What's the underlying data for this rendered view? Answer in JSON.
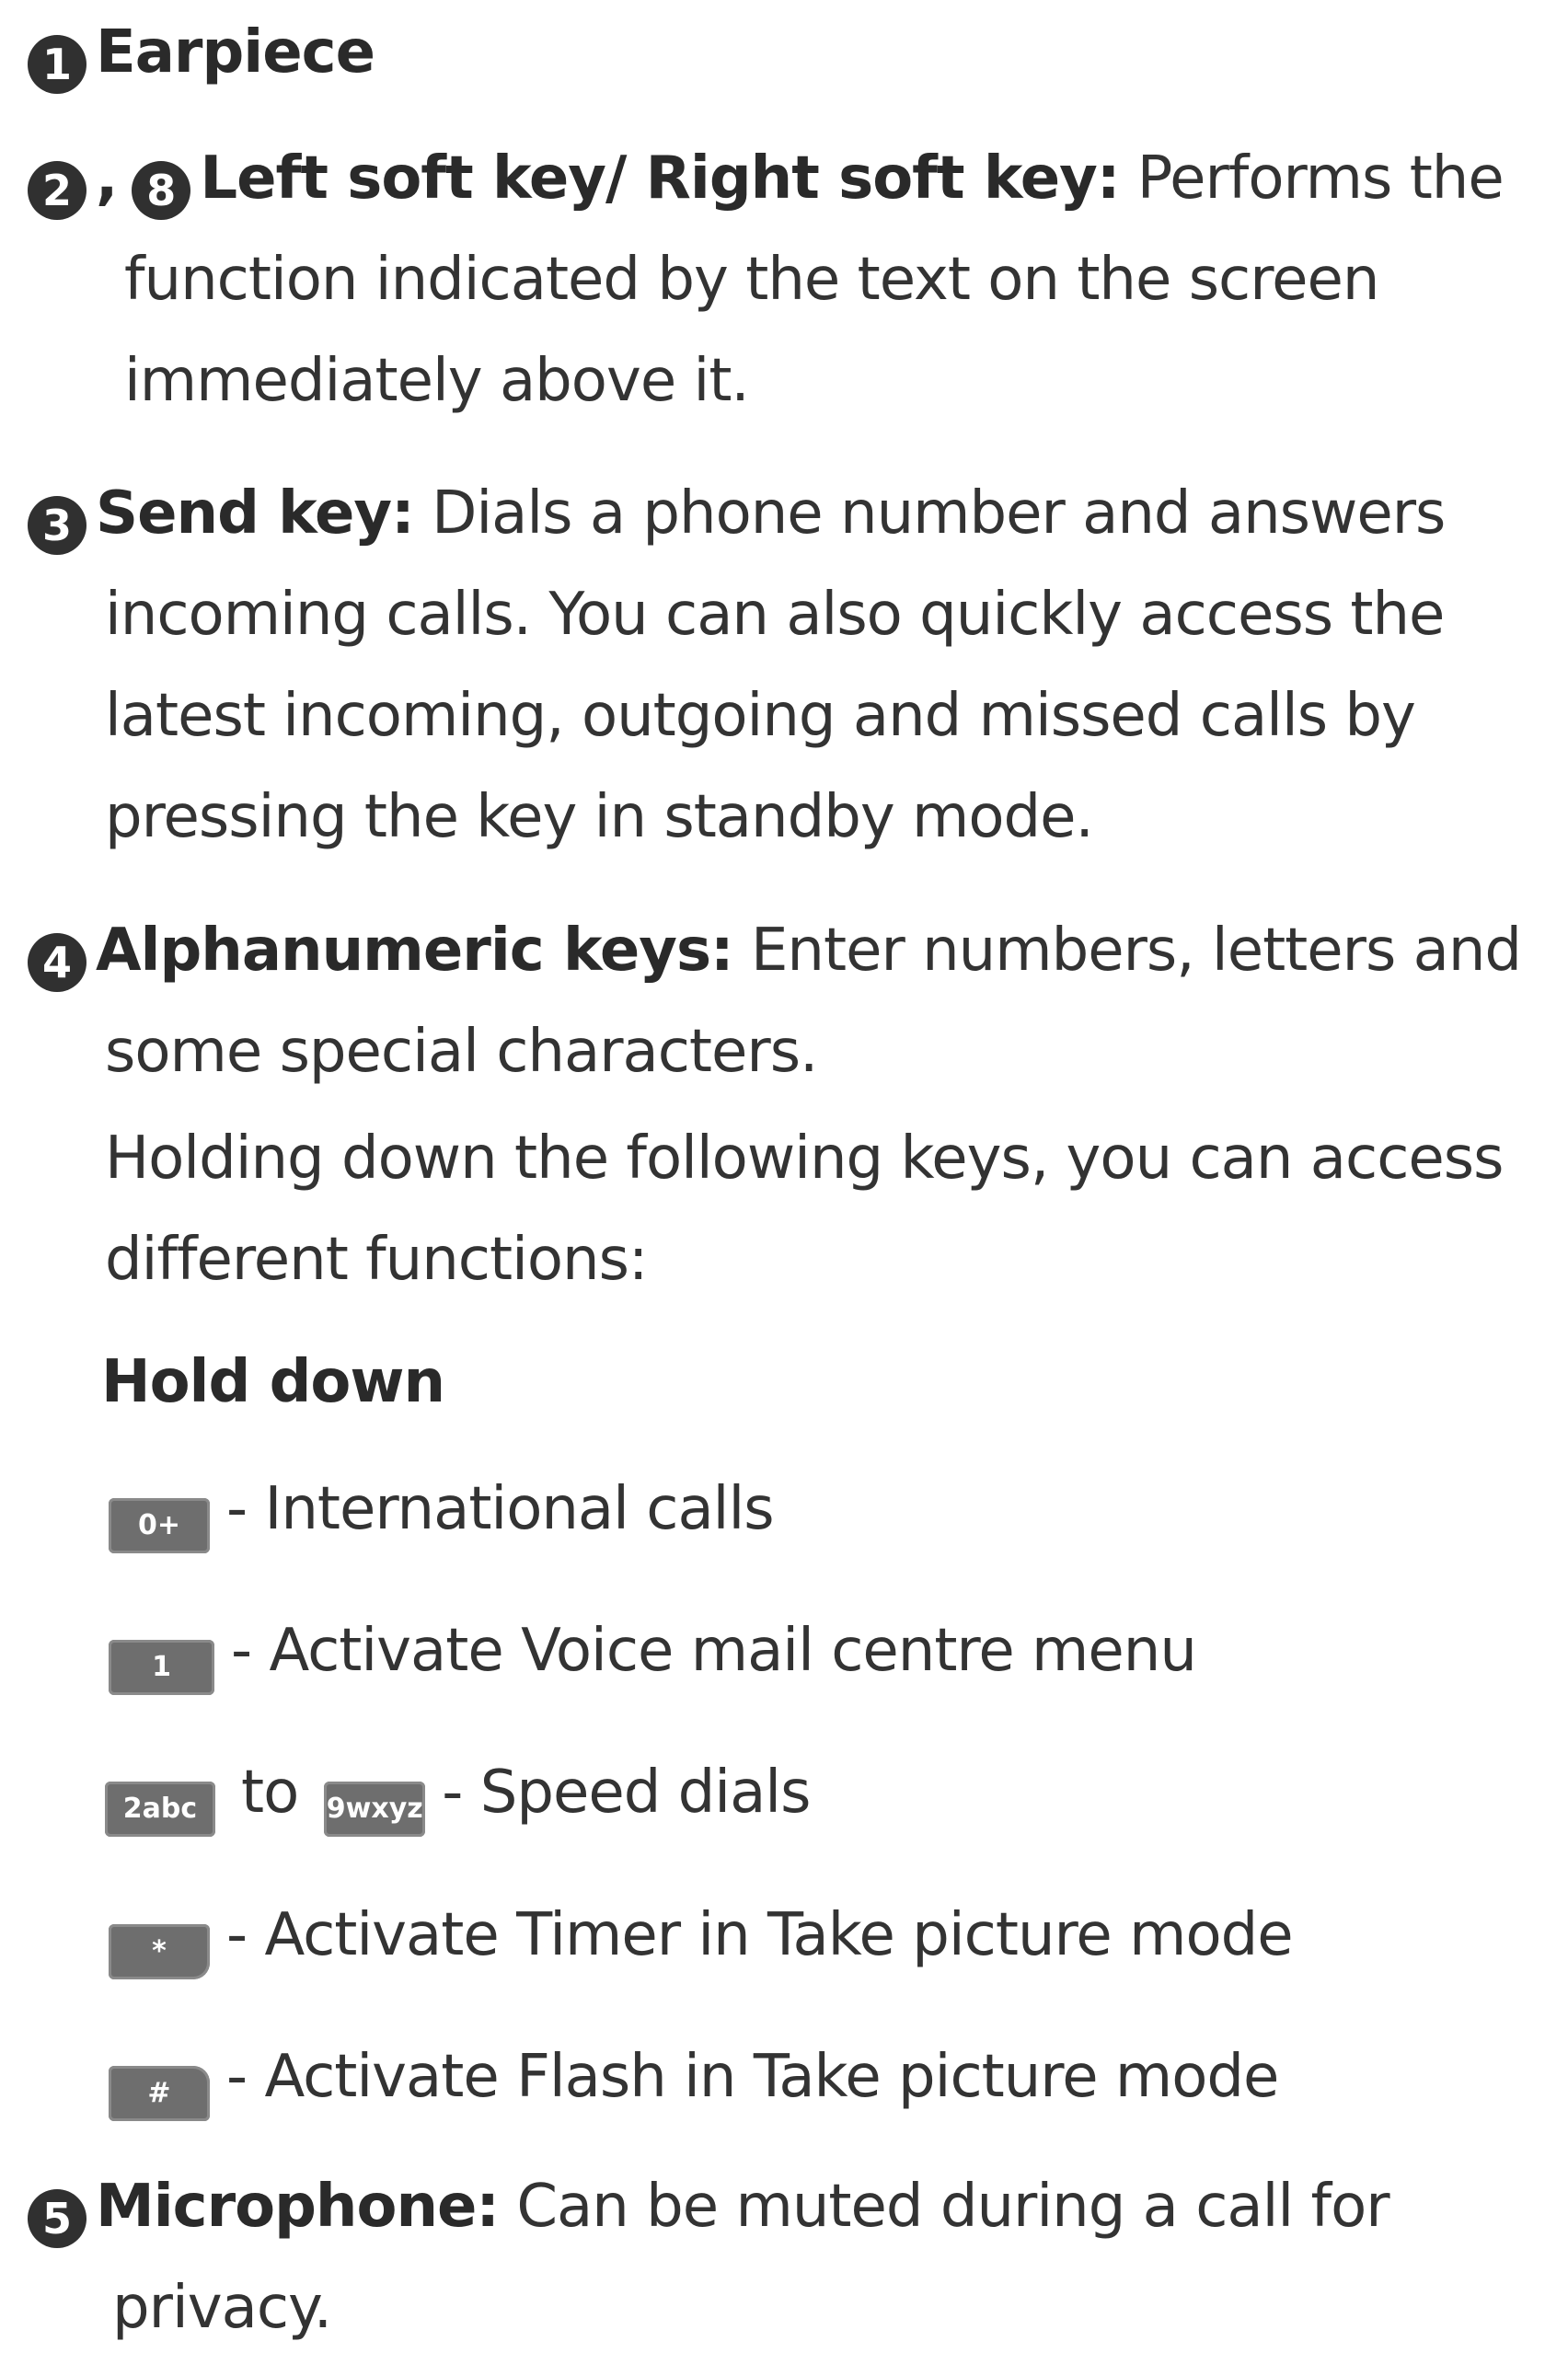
{
  "items": [
    {
      "number": "1",
      "title": "Earpiece"
    },
    {
      "number": "2",
      "number2": "8",
      "title": "Left soft key/ Right soft key:",
      "desc_lines": [
        "Performs the",
        "function indicated by the text on the screen",
        "immediately above it."
      ]
    },
    {
      "number": "3",
      "title": "Send key:",
      "desc_lines": [
        "Dials a phone number and answers",
        "incoming calls. You can also quickly access the",
        "latest incoming, outgoing and missed calls by",
        "pressing the key in standby mode."
      ]
    },
    {
      "number": "4",
      "title": "Alphanumeric keys:",
      "desc_lines": [
        "Enter numbers, letters and",
        "some special characters.",
        "Holding down the following keys, you can access",
        "different functions:"
      ],
      "hold_heading": "Hold down",
      "hold_items": [
        {
          "key": "0+",
          "text": "- International calls"
        },
        {
          "key": "1",
          "text": "- Activate Voice mail centre menu"
        },
        {
          "key_from": "2abc",
          "to_text": "to",
          "key_to": "9wxyz",
          "text": "- Speed dials"
        },
        {
          "key": "*",
          "text": "- Activate Timer in Take picture mode"
        },
        {
          "key": "#",
          "text": "- Activate Flash in Take picture mode"
        }
      ]
    },
    {
      "number": "5",
      "title": "Microphone:",
      "desc_lines": [
        "Can be muted during a call for",
        "privacy."
      ]
    }
  ]
}
